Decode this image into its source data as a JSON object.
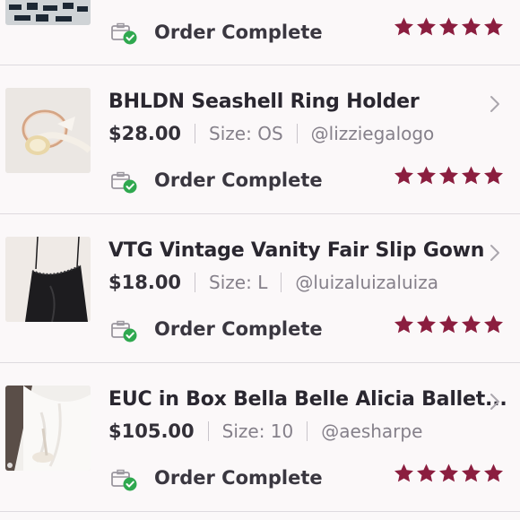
{
  "colors": {
    "star": "#8b1e3f",
    "check": "#2fa84f",
    "divider": "#dedadf"
  },
  "orders": [
    {
      "title": "",
      "price": "",
      "size": "",
      "seller": "",
      "status": "Order Complete",
      "rating": 5
    },
    {
      "title": "BHLDN Seashell Ring Holder",
      "price": "$28.00",
      "size": "Size: OS",
      "seller": "@lizziegalogo",
      "status": "Order Complete",
      "rating": 5
    },
    {
      "title": "VTG Vintage Vanity Fair Slip Gown",
      "price": "$18.00",
      "size": "Size: L",
      "seller": "@luizaluizaluiza",
      "status": "Order Complete",
      "rating": 5
    },
    {
      "title": "EUC in Box Bella Belle Alicia Ballet...",
      "price": "$105.00",
      "size": "Size: 10",
      "seller": "@aesharpe",
      "status": "Order Complete",
      "rating": 5
    }
  ],
  "icons": {
    "chevron": "chevron-right-icon",
    "status": "package-check-icon",
    "star": "star-icon"
  }
}
